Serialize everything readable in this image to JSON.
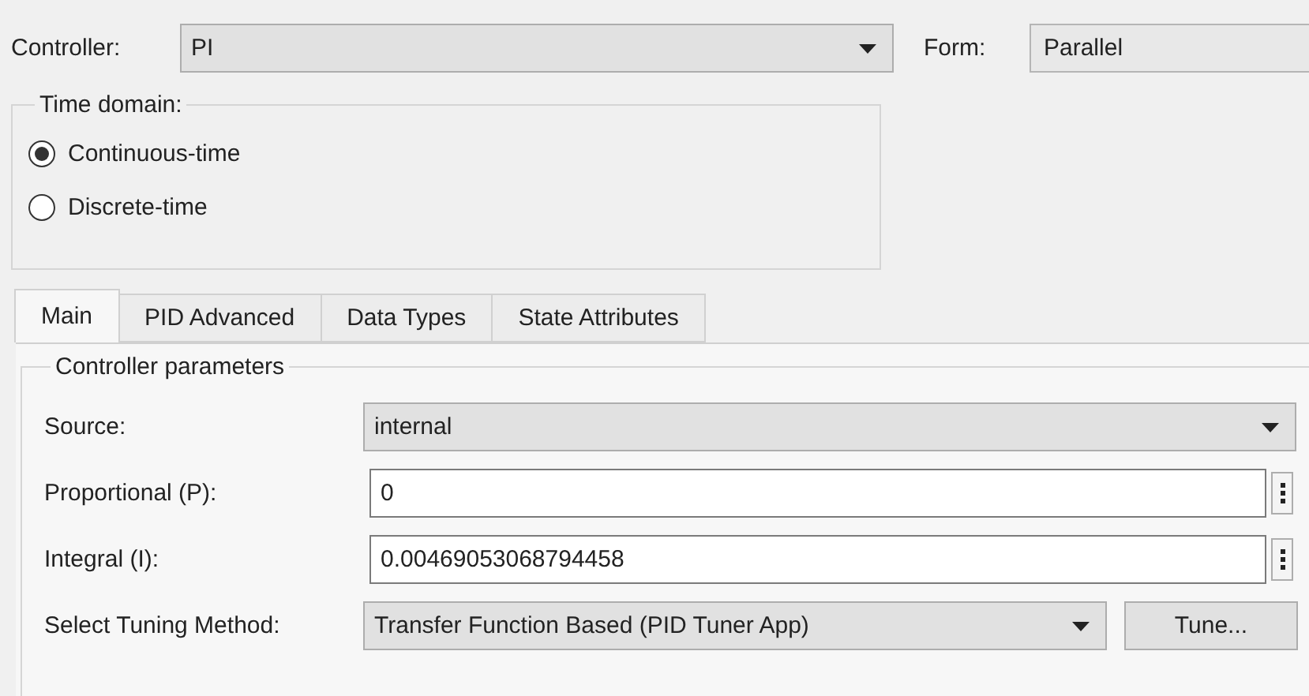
{
  "controller": {
    "label": "Controller:",
    "value": "PI"
  },
  "form": {
    "label": "Form:",
    "value": "Parallel"
  },
  "time_domain": {
    "title": "Time domain:",
    "options": [
      {
        "label": "Continuous-time",
        "selected": true
      },
      {
        "label": "Discrete-time",
        "selected": false
      }
    ]
  },
  "tabs": [
    {
      "label": "Main",
      "selected": true
    },
    {
      "label": "PID Advanced",
      "selected": false
    },
    {
      "label": "Data Types",
      "selected": false
    },
    {
      "label": "State Attributes",
      "selected": false
    }
  ],
  "parameters": {
    "title": "Controller parameters",
    "rows": [
      {
        "kind": "dropdown",
        "label": "Source:",
        "value": "internal"
      },
      {
        "kind": "field",
        "label": "Proportional (P):",
        "value": "0"
      },
      {
        "kind": "field",
        "label": "Integral (I):",
        "value": "0.00469053068794458"
      },
      {
        "kind": "tuning",
        "label": "Select Tuning Method:",
        "value": "Transfer Function Based (PID Tuner App)",
        "button": "Tune..."
      }
    ]
  }
}
